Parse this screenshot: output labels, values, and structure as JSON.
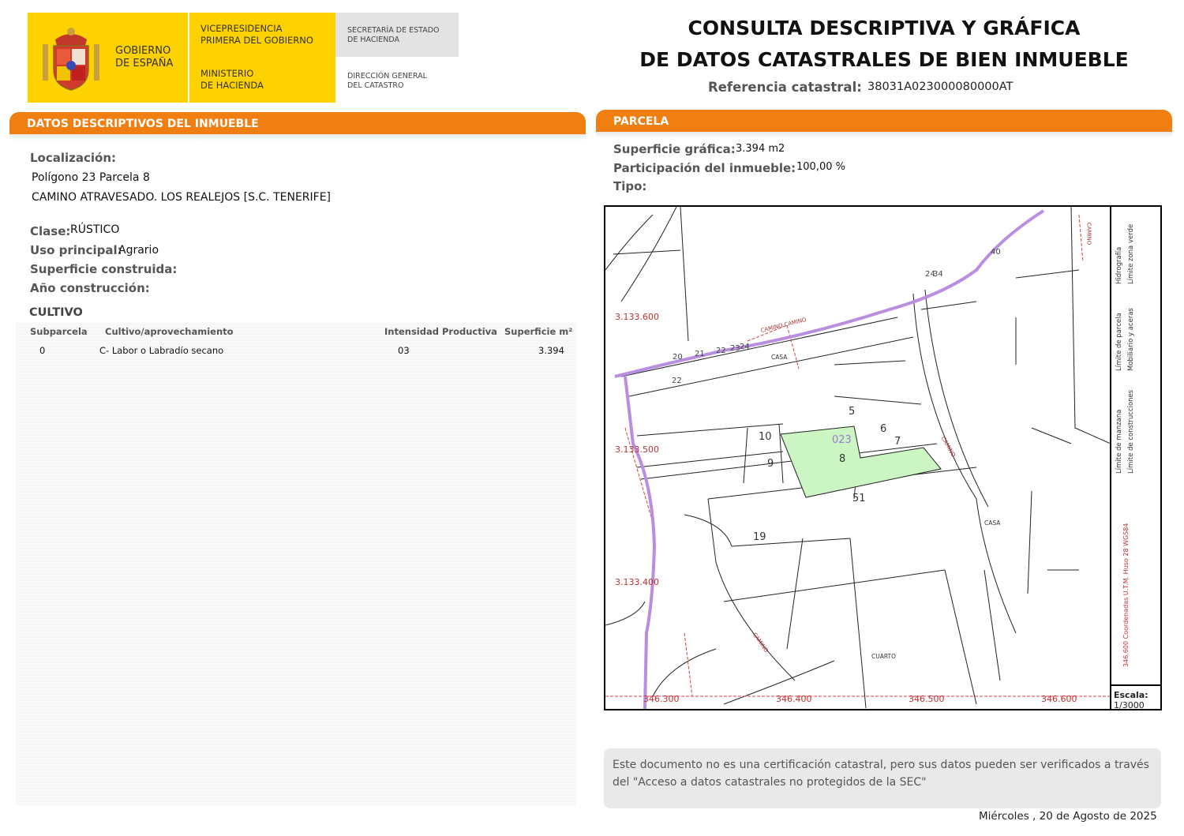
{
  "header": {
    "gobierno": "GOBIERNO\nDE ESPAÑA",
    "vicepresidencia": "VICEPRESIDENCIA\nPRIMERA DEL GOBIERNO",
    "ministerio": "MINISTERIO\nDE HACIENDA",
    "secretaria": "SECRETARÍA DE ESTADO\nDE HACIENDA",
    "direccion": "DIRECCIÓN GENERAL\nDEL CATASTRO",
    "title_line1": "CONSULTA DESCRIPTIVA Y GRÁFICA",
    "title_line2": "DE DATOS CATASTRALES DE BIEN INMUEBLE",
    "ref_label": "Referencia catastral:",
    "ref_value": "38031A023000080000AT"
  },
  "left": {
    "section_title": "DATOS DESCRIPTIVOS DEL INMUEBLE",
    "localizacion_label": "Localización:",
    "localizacion_line1": "Polígono 23 Parcela 8",
    "localizacion_line2": "CAMINO ATRAVESADO. LOS REALEJOS [S.C. TENERIFE]",
    "clase_label": "Clase:",
    "clase_value": "RÚSTICO",
    "uso_label": "Uso principal:",
    "uso_value": "Agrario",
    "superficie_label": "Superficie construida:",
    "anio_label": "Año construcción:",
    "cultivo_title": "CULTIVO",
    "table": {
      "headers": [
        "Subparcela",
        "Cultivo/aprovechamiento",
        "Intensidad Productiva",
        "Superficie m²"
      ],
      "rows": [
        [
          "0",
          "C- Labor o Labradío secano",
          "03",
          "3.394"
        ]
      ]
    }
  },
  "right": {
    "section_title": "PARCELA",
    "superficie_label": "Superficie gráfica:",
    "superficie_value": "3.394 m2",
    "participacion_label": "Participación del inmueble:",
    "participacion_value": "100,00 %",
    "tipo_label": "Tipo:",
    "map": {
      "coords": [
        "3.133.600",
        "3.133.500",
        "3.133.400",
        "346.300",
        "346.400",
        "346.500",
        "346.600"
      ],
      "labels": [
        "CAMINO CAMINO",
        "CASA",
        "CASA",
        "CUARTO",
        "CAMINO",
        "CAMINO",
        "CAMINO",
        "023"
      ],
      "parcels": [
        "20",
        "21",
        "22",
        "23",
        "24",
        "24",
        "22",
        "5",
        "6",
        "7",
        "8",
        "9",
        "10",
        "19",
        "51",
        "34",
        "40"
      ],
      "legend": {
        "manzana": "Límite de manzana",
        "parcela": "Límite de parcela",
        "hidrografia": "Hidrografía",
        "construcciones": "Límite de construcciones",
        "mobiliario": "Mobiliario y aceras",
        "zona_verde": "Límite zona verde",
        "coordenadas": "346.600 Coordenadas U.T.M. Huso 28 WGS84"
      },
      "escala_label": "Escala:",
      "escala_value": "1/3000",
      "colors": {
        "parcel_fill": "#ccf5c4",
        "hydro": "#b98ee0",
        "red_lines": "#d64040"
      }
    },
    "notice": "Este documento no es una certificación catastral, pero sus datos pueden ser verificados a través del \"Acceso a datos catastrales no protegidos de la SEC\"",
    "date": "Miércoles , 20 de Agosto de 2025"
  }
}
